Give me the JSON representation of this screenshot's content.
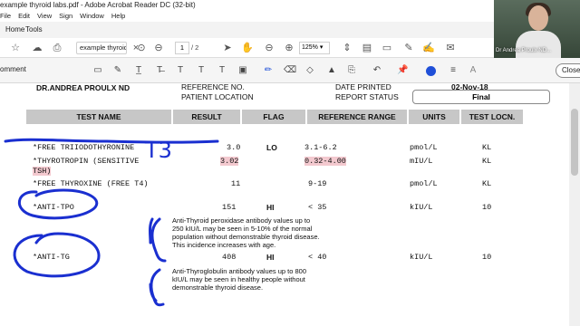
{
  "window": {
    "title": "example thyroid labs.pdf - Adobe Acrobat Reader DC (32-bit)"
  },
  "menu": [
    "File",
    "Edit",
    "View",
    "Sign",
    "Window",
    "Help"
  ],
  "tabs": {
    "home": "Home",
    "tools": "Tools"
  },
  "toolbar": {
    "doc_name": "example thyroid la...",
    "page_current": "1",
    "page_total": "/ 2",
    "zoom": "125%"
  },
  "webcam": {
    "name": "Dr Andrea Proulx ND..."
  },
  "comment_bar": {
    "label": "omment",
    "close_label": "Close"
  },
  "report": {
    "doctor": "DR.ANDREA PROULX ND",
    "reference_no_label": "REFERENCE NO.",
    "patient_location_label": "PATIENT LOCATION",
    "date_printed_label": "DATE PRINTED",
    "date_printed_value": "02-Nov-18",
    "report_status_label": "REPORT STATUS",
    "report_status_value": "Final",
    "columns": [
      "TEST NAME",
      "RESULT",
      "FLAG",
      "REFERENCE RANGE",
      "UNITS",
      "TEST LOCN."
    ],
    "rows": [
      {
        "name": "*FREE TRIIODOTHYRONINE",
        "result": "3.0",
        "flag": "LO",
        "range": "3.1-6.2",
        "units": "pmol/L",
        "locn": "KL"
      },
      {
        "name": "*THYROTROPIN (SENSITIVE",
        "name2": "TSH)",
        "result": "3.02",
        "flag": "",
        "range": "0.32-4.00",
        "units": "mIU/L",
        "locn": "KL"
      },
      {
        "name": "*FREE THYROXINE (FREE T4)",
        "result": "11",
        "flag": "",
        "range": "9-19",
        "units": "pmol/L",
        "locn": "KL"
      },
      {
        "name": "*ANTI-TPO",
        "result": "151",
        "flag": "HI",
        "range": "< 35",
        "units": "kIU/L",
        "locn": "10"
      },
      {
        "name": "*ANTI-TG",
        "result": "408",
        "flag": "HI",
        "range": "< 40",
        "units": "kIU/L",
        "locn": "10"
      }
    ],
    "note_tpo": [
      "Anti-Thyroid peroxidase antibody values up to",
      "250 kIU/L may be seen in 5-10% of the normal",
      "population without demonstrable thyroid disease.",
      "This incidence increases with age."
    ],
    "note_tg": [
      "Anti-Thyroglobulin antibody values up to 800",
      "kIU/L may be seen in healthy people without",
      "demonstrable thyroid disease."
    ]
  },
  "annotation": {
    "handwritten": "T3",
    "ink_color": "#1a2fd0"
  }
}
